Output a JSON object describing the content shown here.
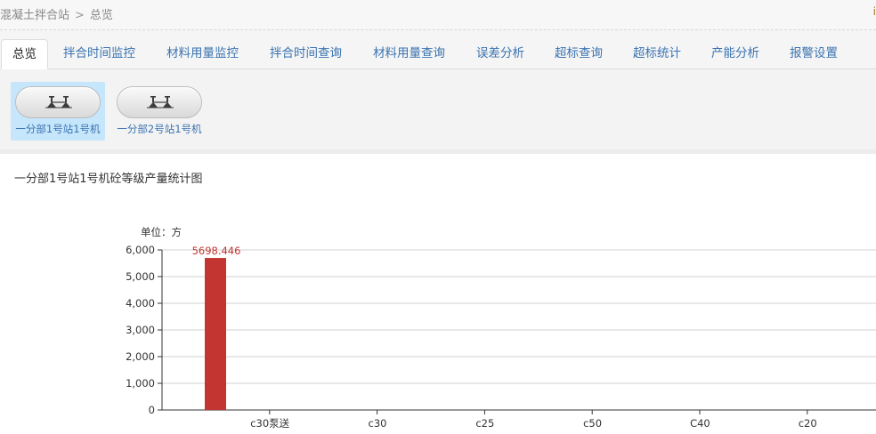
{
  "breadcrumb": {
    "root": "混凝土拌合站",
    "separator": ">",
    "current": "总览"
  },
  "corner_mark": "i",
  "tabs": [
    {
      "label": "总览",
      "active": true
    },
    {
      "label": "拌合时间监控",
      "active": false
    },
    {
      "label": "材料用量监控",
      "active": false
    },
    {
      "label": "拌合时间查询",
      "active": false
    },
    {
      "label": "材料用量查询",
      "active": false
    },
    {
      "label": "误差分析",
      "active": false
    },
    {
      "label": "超标查询",
      "active": false
    },
    {
      "label": "超标统计",
      "active": false
    },
    {
      "label": "产能分析",
      "active": false
    },
    {
      "label": "报警设置",
      "active": false
    }
  ],
  "stations": [
    {
      "label": "一分部1号站1号机",
      "selected": true,
      "icon": "valves-icon"
    },
    {
      "label": "一分部2号站1号机",
      "selected": false,
      "icon": "valves-icon"
    }
  ],
  "colors": {
    "tab_text": "#3a73b0",
    "bar": "#c23531",
    "selected_station": "#c6e6fb"
  },
  "chart_data": {
    "type": "bar",
    "title": "一分部1号站1号机砼等级产量统计图",
    "unit_label": "单位：方",
    "categories": [
      "",
      "c30泵送",
      "c30",
      "c25",
      "c50",
      "C40",
      "c20"
    ],
    "values": [
      5698.446,
      0,
      0,
      0,
      0,
      0,
      0
    ],
    "data_labels": [
      "5698.446",
      "",
      "",
      "",
      "",
      "",
      ""
    ],
    "ylim": [
      0,
      6000
    ],
    "yticks": [
      0,
      1000,
      2000,
      3000,
      4000,
      5000,
      6000
    ],
    "ytick_labels": [
      "0",
      "1,000",
      "2,000",
      "3,000",
      "4,000",
      "5,000",
      "6,000"
    ],
    "grid": true
  }
}
